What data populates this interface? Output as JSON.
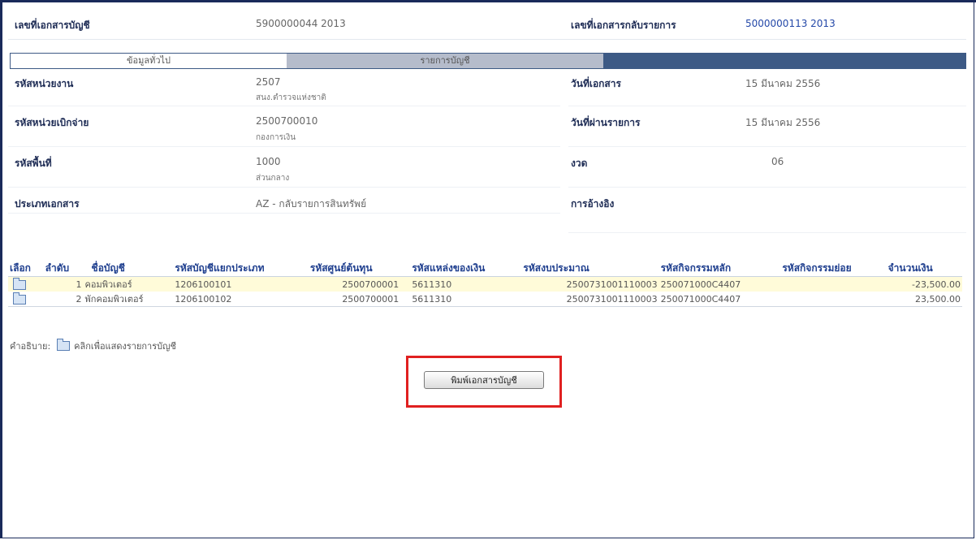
{
  "header": {
    "doc_no_label": "เลขที่เอกสารบัญชี",
    "doc_no_value": "5900000044  2013",
    "reverse_no_label": "เลขที่เอกสารกลับรายการ",
    "reverse_no_value": "5000000113  2013"
  },
  "tabs": [
    {
      "label": "ข้อมูลทั่วไป"
    },
    {
      "label": "รายการบัญชี"
    }
  ],
  "info": {
    "unit_code_label": "รหัสหน่วยงาน",
    "unit_code_value": "2507",
    "unit_code_sub": "สนง.ตำรวจแห่งชาติ",
    "doc_date_label": "วันที่เอกสาร",
    "doc_date_value": "15 มีนาคม 2556",
    "disb_unit_label": "รหัสหน่วยเบิกจ่าย",
    "disb_unit_value": "2500700010",
    "disb_unit_sub": "กองการเงิน",
    "post_date_label": "วันที่ผ่านรายการ",
    "post_date_value": "15 มีนาคม 2556",
    "area_label": "รหัสพื้นที่",
    "area_value": "1000",
    "area_sub": "ส่วนกลาง",
    "period_label": "งวด",
    "period_value": "06",
    "doc_type_label": "ประเภทเอกสาร",
    "doc_type_value": "AZ - กลับรายการสินทรัพย์",
    "reference_label": "การอ้างอิง"
  },
  "table": {
    "columns": [
      "เลือก",
      "ลำดับ",
      "ชื่อบัญชี",
      "รหัสบัญชีแยกประเภท",
      "รหัสศูนย์ต้นทุน",
      "รหัสแหล่งของเงิน",
      "รหัสงบประมาณ",
      "รหัสกิจกรรมหลัก",
      "รหัสกิจกรรมย่อย",
      "จำนวนเงิน"
    ],
    "rows": [
      {
        "seq": "1",
        "name": "คอมพิวเตอร์",
        "gl": "1206100101",
        "cost": "2500700001",
        "fund": "5611310",
        "budget": "2500731001110003",
        "main_act": "250071000C4407",
        "sub_act": "",
        "amount": "-23,500.00"
      },
      {
        "seq": "2",
        "name": "พักคอมพิวเตอร์",
        "gl": "1206100102",
        "cost": "2500700001",
        "fund": "5611310",
        "budget": "2500731001110003",
        "main_act": "250071000C4407",
        "sub_act": "",
        "amount": "23,500.00"
      }
    ]
  },
  "legend": {
    "prefix": "คำอธิบาย:",
    "text": "คลิกเพื่อแสดงรายการบัญชี",
    "icon": "folder-icon"
  },
  "print_button": {
    "label": "พิมพ์เอกสารบัญชี"
  },
  "colors": {
    "highlight": "#e02020",
    "tab_bar": "#3d5a85",
    "header_text": "#1e3e8e"
  }
}
